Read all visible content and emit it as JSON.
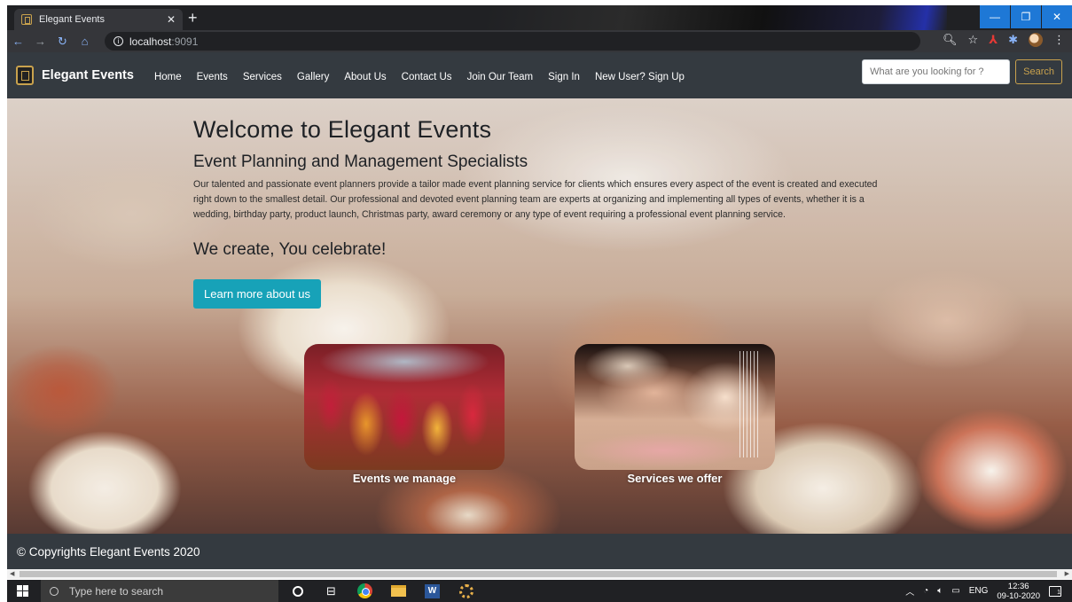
{
  "browser": {
    "tab_title": "Elegant Events",
    "tab_close": "✕",
    "new_tab": "+",
    "url_host": "localhost",
    "url_port": ":9091",
    "window_controls": {
      "minimize": "—",
      "restore": "❐",
      "close": "✕"
    },
    "nav_icons": [
      "back-arrow-icon",
      "forward-arrow-icon",
      "reload-icon",
      "home-icon"
    ]
  },
  "site": {
    "brand": "Elegant Events",
    "nav": [
      "Home",
      "Events",
      "Services",
      "Gallery",
      "About Us",
      "Contact Us",
      "Join Our Team",
      "Sign In",
      "New User? Sign Up"
    ],
    "search_placeholder": "What are you looking for ?",
    "search_button": "Search"
  },
  "hero": {
    "title": "Welcome to Elegant Events",
    "subtitle": "Event Planning and Management Specialists",
    "description": "Our talented and passionate event planners provide a tailor made event planning service for clients which ensures every aspect of the event is created and executed right down to the smallest detail. Our professional and devoted event planning team are experts at organizing and implementing all types of events, whether it is a wedding, birthday party, product launch, Christmas party, award ceremony or any type of event requiring a professional event planning service.",
    "tagline": "We create, You celebrate!",
    "cta": "Learn more about us"
  },
  "cards": [
    {
      "caption": "Events we manage"
    },
    {
      "caption": "Services we offer"
    }
  ],
  "footer": {
    "text": "© Copyrights Elegant Events 2020"
  },
  "taskbar": {
    "search_placeholder": "Type here to search",
    "language": "ENG",
    "time": "12:36",
    "date": "09-10-2020",
    "notifications": "1"
  },
  "colors": {
    "navbar": "#343a40",
    "accent_gold": "#c9a24d",
    "cta": "#17a2b8",
    "chrome_blue": "#1e78d6"
  }
}
